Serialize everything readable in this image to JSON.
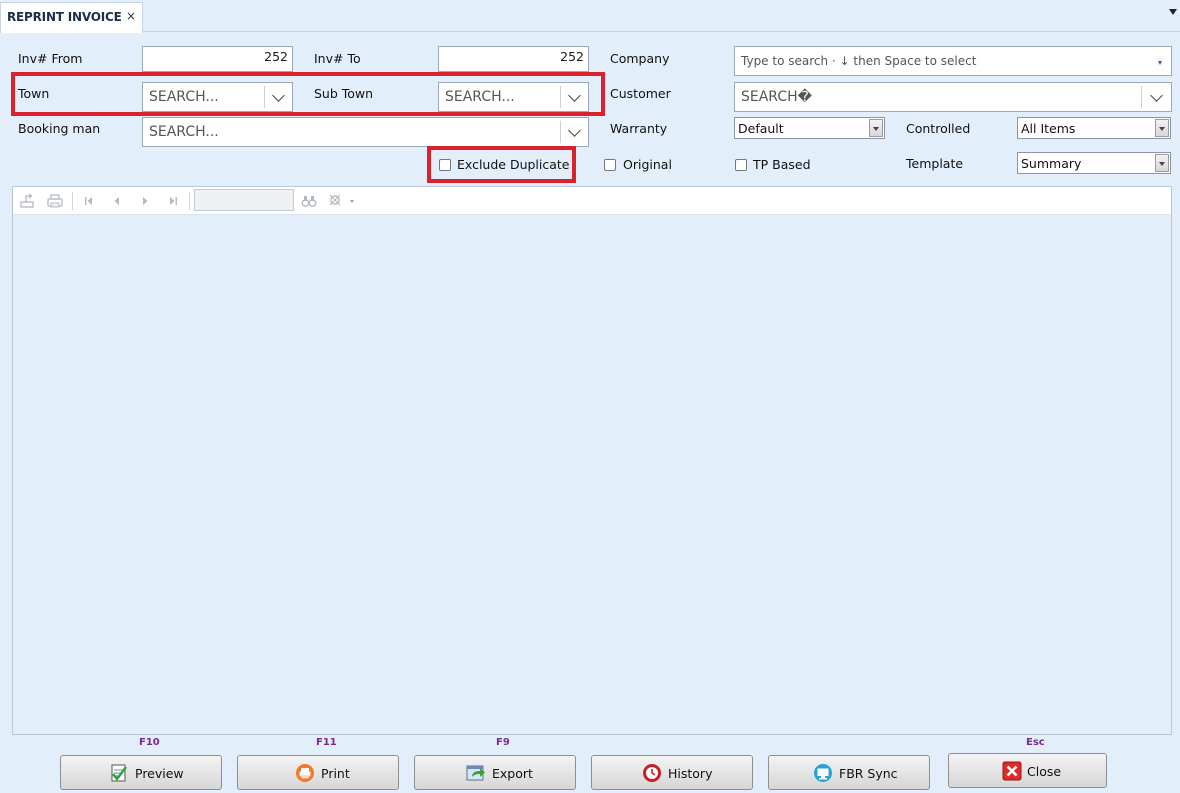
{
  "tab": {
    "title": "REPRINT INVOICE",
    "close": "×"
  },
  "form": {
    "inv_from": {
      "label": "Inv# From",
      "value": "252"
    },
    "inv_to": {
      "label": "Inv# To",
      "value": "252"
    },
    "company": {
      "label": "Company",
      "placeholder": "Type to search · ↓ then Space to select"
    },
    "town": {
      "label": "Town",
      "value": "SEARCH..."
    },
    "sub_town": {
      "label": "Sub Town",
      "value": "SEARCH..."
    },
    "customer": {
      "label": "Customer",
      "value": "SEARCH�"
    },
    "booking_man": {
      "label": "Booking man",
      "value": "SEARCH..."
    },
    "warranty": {
      "label": "Warranty",
      "value": "Default"
    },
    "controlled": {
      "label": "Controlled",
      "value": "All Items"
    },
    "template": {
      "label": "Template",
      "value": "Summary"
    },
    "exclude_duplicate": {
      "label": "Exclude Duplicate",
      "checked": false
    },
    "original": {
      "label": "Original",
      "checked": false
    },
    "tp_based": {
      "label": "TP Based",
      "checked": false
    }
  },
  "buttons": [
    {
      "key": "F10",
      "label": "Preview",
      "icon": "preview-icon"
    },
    {
      "key": "F11",
      "label": "Print",
      "icon": "print-icon"
    },
    {
      "key": "F9",
      "label": "Export",
      "icon": "export-icon"
    },
    {
      "key": "",
      "label": "History",
      "icon": "history-icon"
    },
    {
      "key": "",
      "label": "FBR Sync",
      "icon": "fbr-sync-icon"
    },
    {
      "key": "Esc",
      "label": "Close",
      "icon": "close-icon"
    }
  ],
  "colors": {
    "highlight": "#d9222e",
    "background": "#e3eefb",
    "fkey": "#7a2a8f"
  }
}
